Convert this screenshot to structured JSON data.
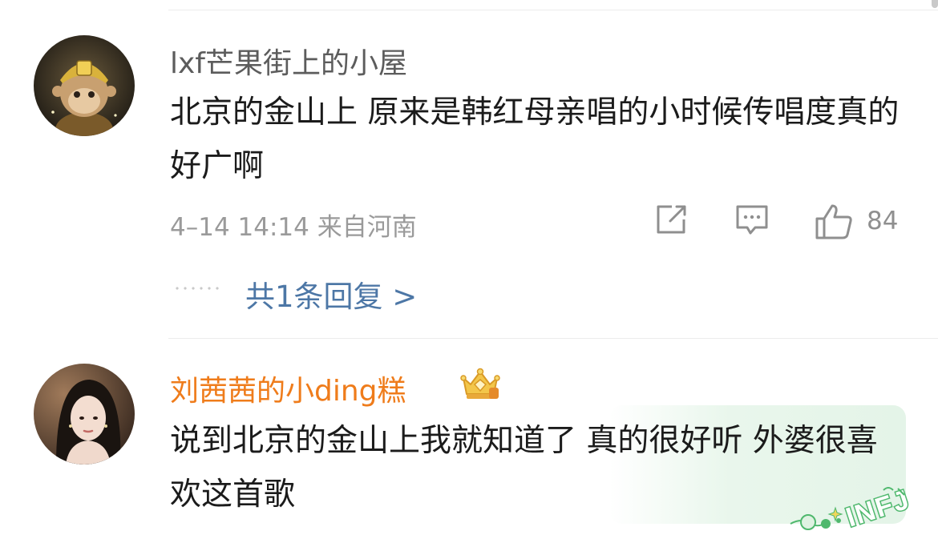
{
  "comments": [
    {
      "username": "lxf芒果街上的小屋",
      "text": "北京的金山上 原来是韩红母亲唱的小时候传唱度真的好广啊",
      "meta": "4–14 14:14 来自河南",
      "like_count": "84",
      "reply_link": "共1条回复 >",
      "avatar_icon": "monkey-king-avatar",
      "username_color": "#5c5c5c"
    },
    {
      "username": "刘茜茜的小ding糕",
      "text": "说到北京的金山上我就知道了 真的很好听 外婆很喜欢这首歌",
      "badge_icon": "crown-badge-icon",
      "avatar_icon": "woman-portrait-avatar",
      "username_color": "#ef7c1b"
    }
  ],
  "action_icons": [
    "share-icon",
    "comment-icon",
    "like-icon"
  ],
  "watermark": {
    "text": "INFJ",
    "color": "#4fb86d"
  },
  "colors": {
    "link": "#4d77a6",
    "meta": "#9a9a9a",
    "body_text": "#1b1b1b"
  }
}
